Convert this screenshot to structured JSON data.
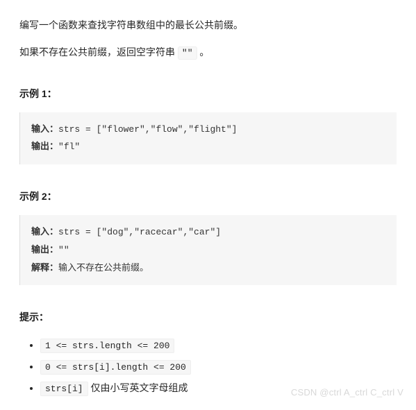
{
  "description": {
    "p1": "编写一个函数来查找字符串数组中的最长公共前缀。",
    "p2_prefix": "如果不存在公共前缀，返回空字符串 ",
    "p2_code": "\"\"",
    "p2_suffix": " 。"
  },
  "examples": {
    "ex1": {
      "title": "示例 1：",
      "input_label": "输入：",
      "input_code": "strs = [\"flower\",\"flow\",\"flight\"]",
      "output_label": "输出：",
      "output_code": "\"fl\""
    },
    "ex2": {
      "title": "示例 2：",
      "input_label": "输入：",
      "input_code": "strs = [\"dog\",\"racecar\",\"car\"]",
      "output_label": "输出：",
      "output_code": "\"\"",
      "explain_label": "解释：",
      "explain_text": "输入不存在公共前缀。"
    }
  },
  "hints": {
    "title": "提示：",
    "items": [
      "1 <= strs.length <= 200",
      "0 <= strs[i].length <= 200"
    ],
    "item3_code": "strs[i]",
    "item3_text": " 仅由小写英文字母组成"
  },
  "watermark": "CSDN @ctrl A_ctrl C_ctrl V"
}
